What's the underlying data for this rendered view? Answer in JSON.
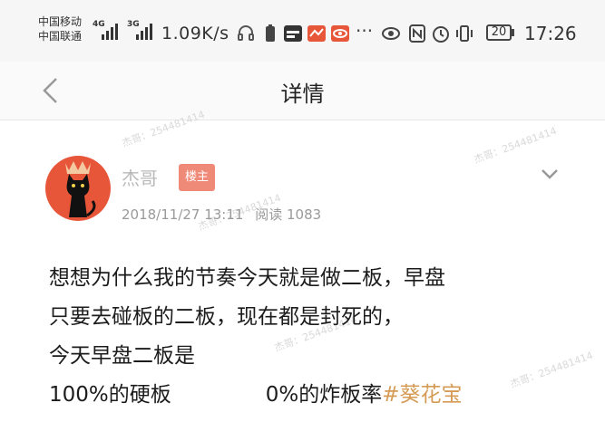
{
  "status_bar": {
    "carrier_1": "中国移动",
    "carrier_2": "中国联通",
    "net_1": "4G",
    "net_2": "3G",
    "speed": "1.09K/s",
    "battery": "20",
    "time": "17:26",
    "more": "···",
    "icons": [
      "signal-icon",
      "headset-icon",
      "app-icon",
      "weather-icon",
      "eye-icon",
      "nfc-icon",
      "alarm-icon",
      "vibrate-icon",
      "battery-icon"
    ]
  },
  "nav": {
    "title": "详情",
    "back_icon": "chevron-left-icon"
  },
  "post": {
    "author": "杰哥",
    "badge": "楼主",
    "date": "2018/11/27 13:11",
    "reads": "阅读 1083",
    "lines": [
      "想想为什么我的节奏今天就是做二板，早盘",
      "只要去碰板的二板，现在都是封死的，",
      "今天早盘二板是"
    ],
    "last_line": {
      "left": "100%的硬板",
      "right": "0%的炸板率",
      "tag": "#葵花宝"
    }
  },
  "watermark": "杰哥：254481414",
  "colors": {
    "badge": "#f08a78",
    "avatar_bg": "#e8563a",
    "tag": "#d59b55",
    "muted": "#9a9a9a"
  }
}
